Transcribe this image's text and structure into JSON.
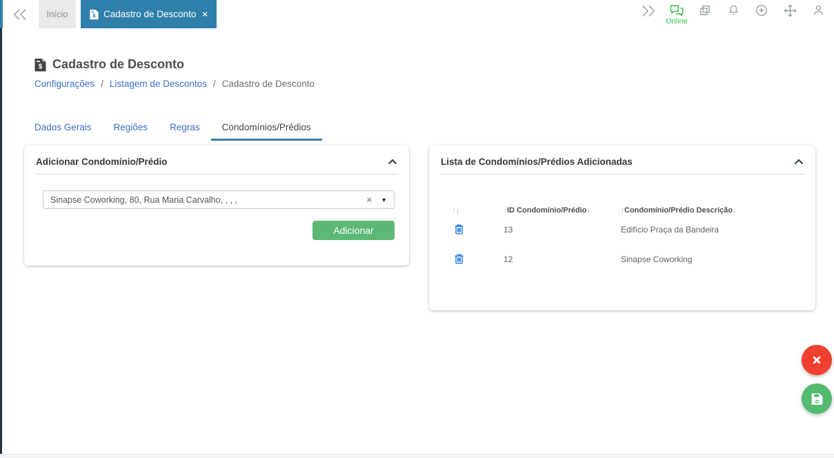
{
  "topbar": {
    "tab_home": "Início",
    "tab_active": "Cadastro de Desconto",
    "close_glyph": "×",
    "online_label": "Online",
    "doc_glyph": "$"
  },
  "page": {
    "title": "Cadastro de Desconto",
    "doc_glyph": "$",
    "breadcrumb": {
      "sep": "/",
      "items": [
        "Configurações",
        "Listagem de Descontos",
        "Cadastro de Desconto"
      ]
    },
    "tabs": [
      "Dados Gerais",
      "Regiões",
      "Regras",
      "Condomínios/Prédios"
    ]
  },
  "add_panel": {
    "title": "Adicionar Condomínio/Prédio",
    "select_value": "Sinapse Coworking, 80, Rua Maria Carvalho, , , ,",
    "clear_glyph": "×",
    "caret_glyph": "▼",
    "add_button": "Adicionar"
  },
  "list_panel": {
    "title": "Lista de Condomínios/Prédios Adicionadas",
    "sort_up": "↑",
    "sort_down": "↓",
    "columns": [
      "ID Condomínio/Prédio",
      "Condomínio/Prédio Descrição"
    ],
    "rows": [
      {
        "id": "13",
        "description": "Edifício Praça da Bandeira"
      },
      {
        "id": "12",
        "description": "Sinapse Coworking"
      }
    ]
  },
  "colors": {
    "accent_teal": "#2e80ab",
    "sidebar_navy": "#20303d",
    "link_blue": "#3a70c8",
    "online_green": "#3cc24e",
    "button_green": "#5cb876",
    "fab_red": "#f1402f",
    "fab_green": "#53ba70",
    "trash_blue": "#1e7ae4"
  }
}
